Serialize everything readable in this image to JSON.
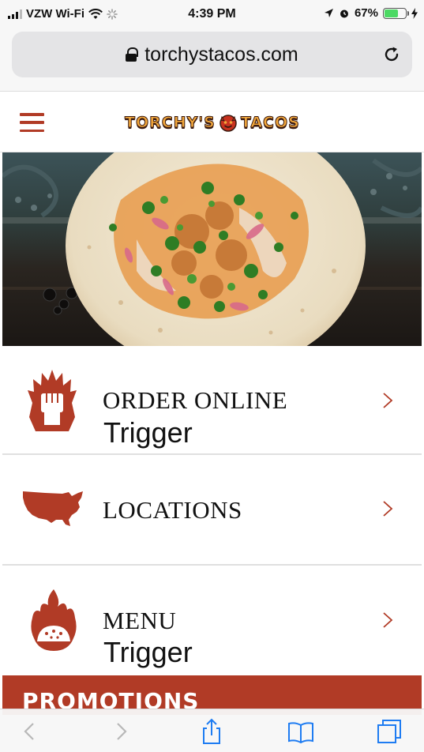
{
  "status_bar": {
    "carrier": "VZW Wi-Fi",
    "time": "4:39 PM",
    "battery_percent": "67%",
    "battery_level": 0.67
  },
  "browser": {
    "url": "torchystacos.com"
  },
  "site": {
    "logo_left": "Torchy's",
    "logo_right": "Tacos"
  },
  "nav": {
    "items": [
      {
        "label": "ORDER ONLINE",
        "sub": "Trigger",
        "icon": "fist-flame-icon"
      },
      {
        "label": "LOCATIONS",
        "sub": "",
        "icon": "usa-map-icon"
      },
      {
        "label": "MENU",
        "sub": "Trigger",
        "icon": "taco-flame-icon"
      }
    ]
  },
  "promo": {
    "label": "PROMOTIONS"
  },
  "colors": {
    "brand_red": "#b13b26",
    "logo_orange": "#f2a73b",
    "ios_blue": "#1e7cf2"
  }
}
